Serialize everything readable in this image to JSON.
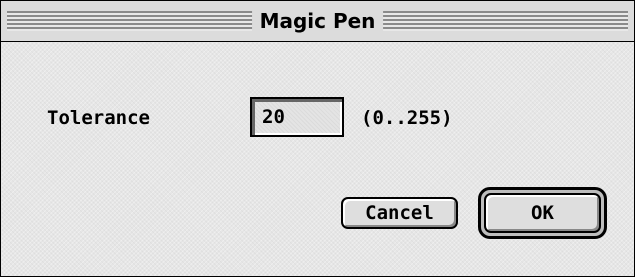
{
  "window": {
    "title": "Magic Pen"
  },
  "form": {
    "tolerance_label": "Tolerance",
    "tolerance_value": "20",
    "range_hint": "(0..255)"
  },
  "buttons": {
    "cancel_label": "Cancel",
    "ok_label": "OK"
  }
}
